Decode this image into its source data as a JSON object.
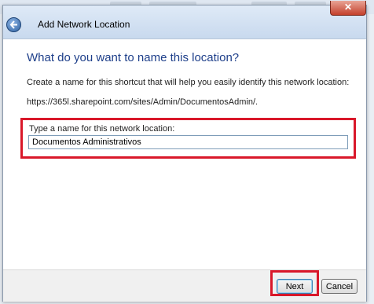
{
  "window": {
    "title": "Add Network Location"
  },
  "icons": {
    "back": "back-arrow-icon",
    "close": "close-icon"
  },
  "main": {
    "heading": "What do you want to name this location?",
    "description": "Create a name for this shortcut that will help you easily identify this network location:",
    "url": "https://365l.sharepoint.com/sites/Admin/DocumentosAdmin/."
  },
  "form": {
    "label": "Type a name for this network location:",
    "value": "Documentos Administrativos"
  },
  "footer": {
    "next_label": "Next",
    "cancel_label": "Cancel"
  },
  "colors": {
    "heading": "#1e3f8a",
    "highlight": "#d9182a"
  }
}
